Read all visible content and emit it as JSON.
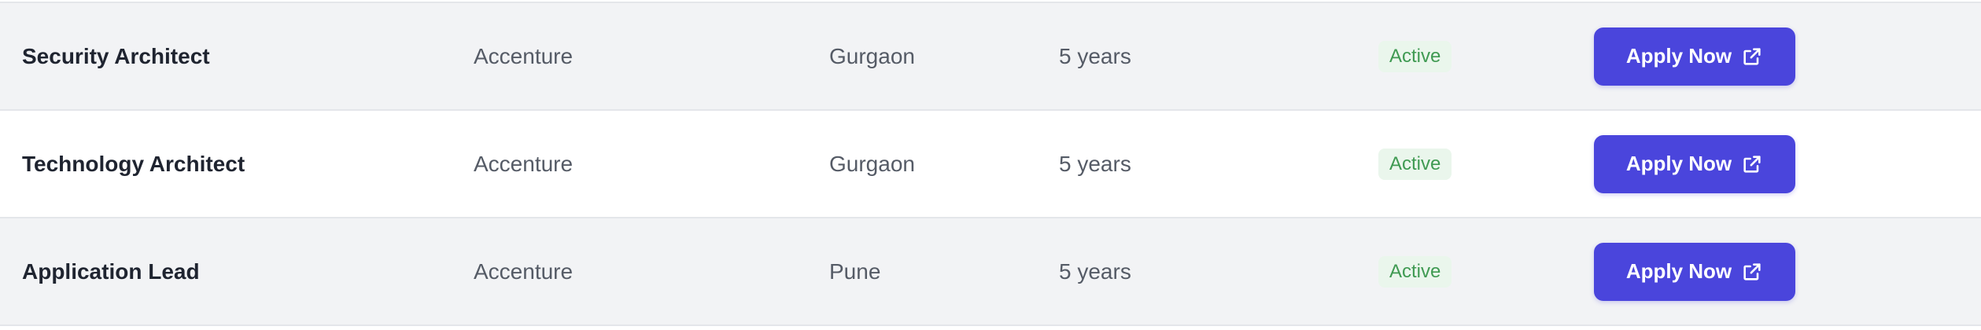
{
  "jobs": [
    {
      "role": "Security Architect",
      "company": "Accenture",
      "location": "Gurgaon",
      "experience": "5 years",
      "status": "Active",
      "apply_label": "Apply Now"
    },
    {
      "role": "Technology Architect",
      "company": "Accenture",
      "location": "Gurgaon",
      "experience": "5 years",
      "status": "Active",
      "apply_label": "Apply Now"
    },
    {
      "role": "Application Lead",
      "company": "Accenture",
      "location": "Pune",
      "experience": "5 years",
      "status": "Active",
      "apply_label": "Apply Now"
    }
  ],
  "icons": {
    "apply_icon": "external-link-icon"
  },
  "colors": {
    "accent": "#4a45dc",
    "status_active": "#3f9a52",
    "row_alt": "#f2f3f5"
  }
}
